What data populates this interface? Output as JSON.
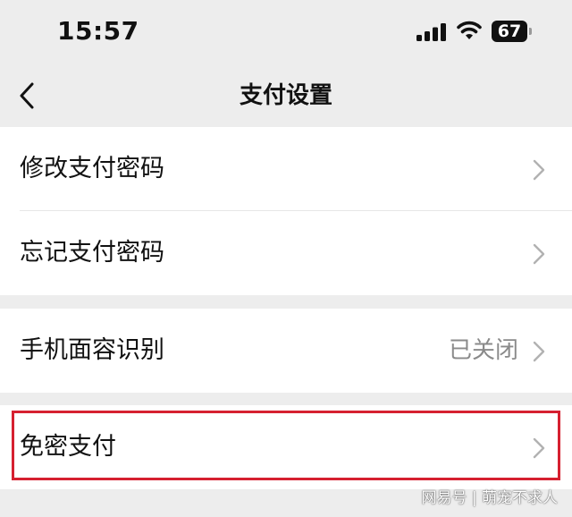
{
  "status_bar": {
    "time": "15:57",
    "battery_level": "67",
    "icons": [
      "signal-icon",
      "wifi-icon",
      "battery-icon"
    ]
  },
  "nav": {
    "back_icon": "back-chevron-icon",
    "title": "支付设置"
  },
  "groups": [
    {
      "items": [
        {
          "label": "修改支付密码",
          "value": ""
        },
        {
          "label": "忘记支付密码",
          "value": ""
        }
      ]
    },
    {
      "items": [
        {
          "label": "手机面容识别",
          "value": "已关闭"
        }
      ]
    },
    {
      "items": [
        {
          "label": "免密支付",
          "value": "",
          "highlighted": true
        }
      ]
    }
  ],
  "colors": {
    "background": "#ededed",
    "card": "#ffffff",
    "highlight": "#d62030",
    "secondary_text": "#8a8a8a",
    "chevron": "#b2b2b2"
  },
  "watermark": {
    "text": "网易号 | 萌宠不求人"
  }
}
